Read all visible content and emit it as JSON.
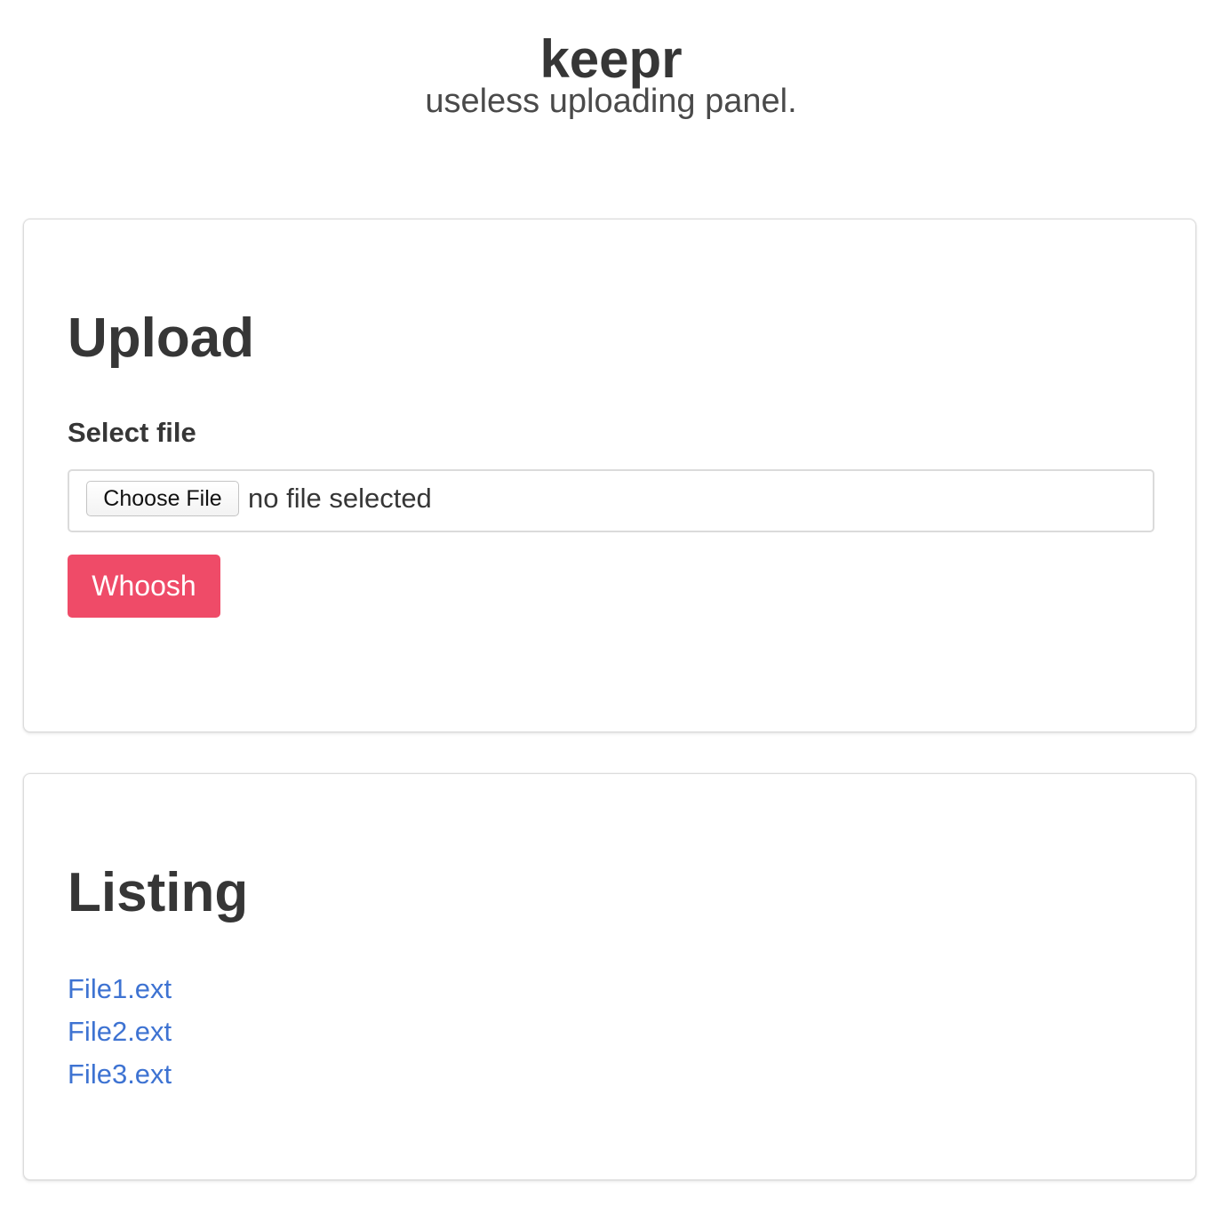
{
  "header": {
    "title": "keepr",
    "subtitle": "useless uploading panel."
  },
  "upload": {
    "title": "Upload",
    "field_label": "Select file",
    "choose_button_label": "Choose File",
    "file_status": "no file selected",
    "submit_label": "Whoosh"
  },
  "listing": {
    "title": "Listing",
    "files": [
      "File1.ext",
      "File2.ext",
      "File3.ext"
    ]
  },
  "colors": {
    "accent": "#ef4b68",
    "link": "#3e73d2",
    "text": "#363636"
  }
}
